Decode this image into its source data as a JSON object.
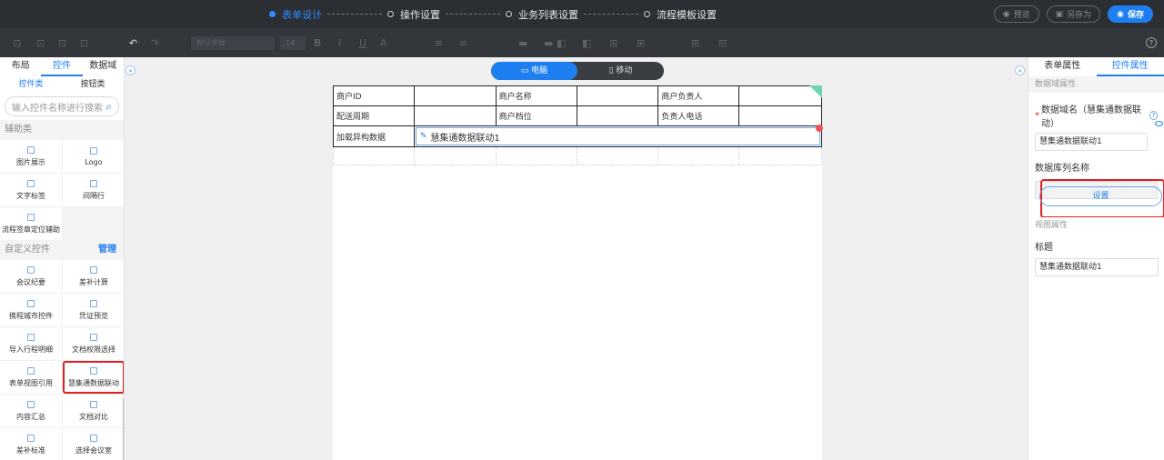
{
  "steps": [
    {
      "label": "表单设计",
      "active": true
    },
    {
      "label": "操作设置",
      "active": false
    },
    {
      "label": "业务列表设置",
      "active": false
    },
    {
      "label": "流程模板设置",
      "active": false
    }
  ],
  "top_actions": {
    "preview": "预览",
    "save_as": "另存为",
    "save": "保存"
  },
  "toolbar": {
    "font_select": "默认字体",
    "size_select": "14"
  },
  "left": {
    "tabs": [
      "布局",
      "控件",
      "数据域"
    ],
    "subtabs": [
      "控件类",
      "按钮类"
    ],
    "search_placeholder": "输入控件名称进行搜索",
    "cat_assist": "辅助类",
    "cat_custom": "自定义控件",
    "manage": "管理",
    "assist_items": [
      "图片展示",
      "Logo",
      "文字标签",
      "间隔行",
      "流程签章定位辅助"
    ],
    "custom_items": [
      "会议纪要",
      "差补计算",
      "携程城市控件",
      "凭证预览",
      "导入行程明细",
      "文档权限选择",
      "表单视图引用",
      "慧集通数据联动",
      "内容汇总",
      "文档对比",
      "差补标准",
      "选择会议室"
    ]
  },
  "canvas": {
    "device": {
      "pc": "电脑",
      "mobile": "移动"
    },
    "rows": [
      [
        "商户ID",
        "",
        "商户名称",
        "",
        "商户负责人",
        ""
      ],
      [
        "配送周期",
        "",
        "商户档位",
        "",
        "负责人电话",
        ""
      ]
    ],
    "row3_label": "加载异构数据",
    "linked_control": "慧集通数据联动1"
  },
  "right": {
    "tabs": [
      "表单属性",
      "控件属性"
    ],
    "sec_data": "数据域属性",
    "data_field_label": "数据域名（慧集通数据联动）",
    "data_field_value": "慧集通数据联动1",
    "db_col_label": "数据库列名称",
    "db_col_value": "",
    "set_button": "设置",
    "sec_view": "视图属性",
    "title_label": "标题",
    "title_value": "慧集通数据联动1"
  }
}
